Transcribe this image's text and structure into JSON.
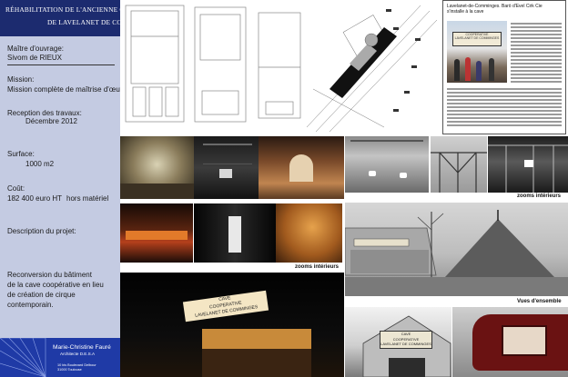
{
  "header": {
    "title_line1": "RÉHABILITATION DE L'ANCIENNE CAVE COOPÉRATIVE",
    "title_line2": "DE LAVELANET DE COMMINGES"
  },
  "project": {
    "owner_label": "Maître d'ouvrage:",
    "owner_value": "Sivom de RIEUX",
    "mission_label": "Mission:",
    "mission_value": "Mission complète de maîtrise d'œuvre",
    "reception_label": "Reception des travaux:",
    "reception_value": "Décembre 2012",
    "surface_label": "Surface:",
    "surface_value": "1000 m2",
    "cost_label": "Coût:",
    "cost_value": "182  400 euro HT",
    "cost_note": "hors matériel",
    "description_label": "Description du projet:",
    "description_lines": [
      "Reconversion du bâtiment",
      "de la cave coopérative en lieu",
      "de création de cirque",
      "contemporain."
    ]
  },
  "architect": {
    "name": "Marie-Christine Fauré",
    "title": "Architecte D.E.S.A",
    "address_line1": "10 bis Boulevard Delbour",
    "address_line2": "31000 Toulouse"
  },
  "press": {
    "headline_line1": "Lavelanet-de-Comminges. Barò d'Evel Cirk Cie",
    "headline_line2": "s'installe à la cave"
  },
  "captions": {
    "zooms_interieurs_1": "zooms intérieurs",
    "zooms_interieurs_2": "zooms intérieurs",
    "vues_ensemble": "Vues d'ensemble"
  },
  "signs": {
    "cave_line1": "CAVE",
    "cave_line2": "COOPERATIVE",
    "cave_line3": "LAVELANET DE COMMINGES"
  },
  "colors": {
    "sidebar_bg": "#c4cbe2",
    "title_bg": "#1c2b6f",
    "author_bg": "#1f3aa6"
  }
}
